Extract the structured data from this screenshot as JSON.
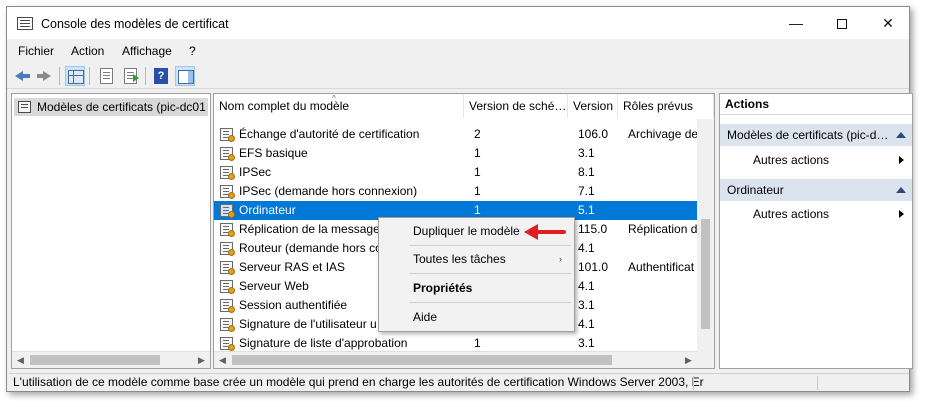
{
  "window": {
    "title": "Console des modèles de certificat",
    "controls": {
      "minimize": "—",
      "close": "✕"
    }
  },
  "menu": [
    "Fichier",
    "Action",
    "Affichage",
    "?"
  ],
  "tree": {
    "root_label": "Modèles de certificats (pic-dc01"
  },
  "table": {
    "columns": [
      "Nom complet du modèle",
      "Version de sché…",
      "Version",
      "Rôles prévus"
    ],
    "rows": [
      {
        "name": "Échange d'autorité de certification",
        "schema": "2",
        "version": "106.0",
        "roles": "Archivage de"
      },
      {
        "name": "EFS basique",
        "schema": "1",
        "version": "3.1",
        "roles": ""
      },
      {
        "name": "IPSec",
        "schema": "1",
        "version": "8.1",
        "roles": ""
      },
      {
        "name": "IPSec (demande hors connexion)",
        "schema": "1",
        "version": "7.1",
        "roles": ""
      },
      {
        "name": "Ordinateur",
        "schema": "1",
        "version": "5.1",
        "roles": ""
      },
      {
        "name": "Réplication de la messager",
        "schema": "",
        "version": "115.0",
        "roles": "Réplication d"
      },
      {
        "name": "Routeur (demande hors co",
        "schema": "",
        "version": "4.1",
        "roles": ""
      },
      {
        "name": "Serveur RAS et IAS",
        "schema": "",
        "version": "101.0",
        "roles": "Authentificat"
      },
      {
        "name": "Serveur Web",
        "schema": "",
        "version": "4.1",
        "roles": ""
      },
      {
        "name": "Session authentifiée",
        "schema": "",
        "version": "3.1",
        "roles": ""
      },
      {
        "name": "Signature de l'utilisateur u",
        "schema": "",
        "version": "4.1",
        "roles": ""
      },
      {
        "name": "Signature de liste d'approbation",
        "schema": "1",
        "version": "3.1",
        "roles": ""
      }
    ],
    "selected_row": "Ordinateur"
  },
  "context_menu": {
    "items": [
      "Dupliquer le modèle",
      "Toutes les tâches",
      "Propriétés",
      "Aide"
    ],
    "submenu_arrow": "›"
  },
  "actions": {
    "title": "Actions",
    "sections": [
      {
        "label": "Modèles de certificats (pic-d…",
        "item": "Autres actions"
      },
      {
        "label": "Ordinateur",
        "item": "Autres actions"
      }
    ]
  },
  "status": "L'utilisation de ce modèle comme base crée un modèle qui prend en charge les autorités de certification Windows Server 2003, Er",
  "colors": {
    "selection": "#0078d7",
    "annotation_arrow": "#e02020",
    "section_header": "#dbe3ee"
  }
}
